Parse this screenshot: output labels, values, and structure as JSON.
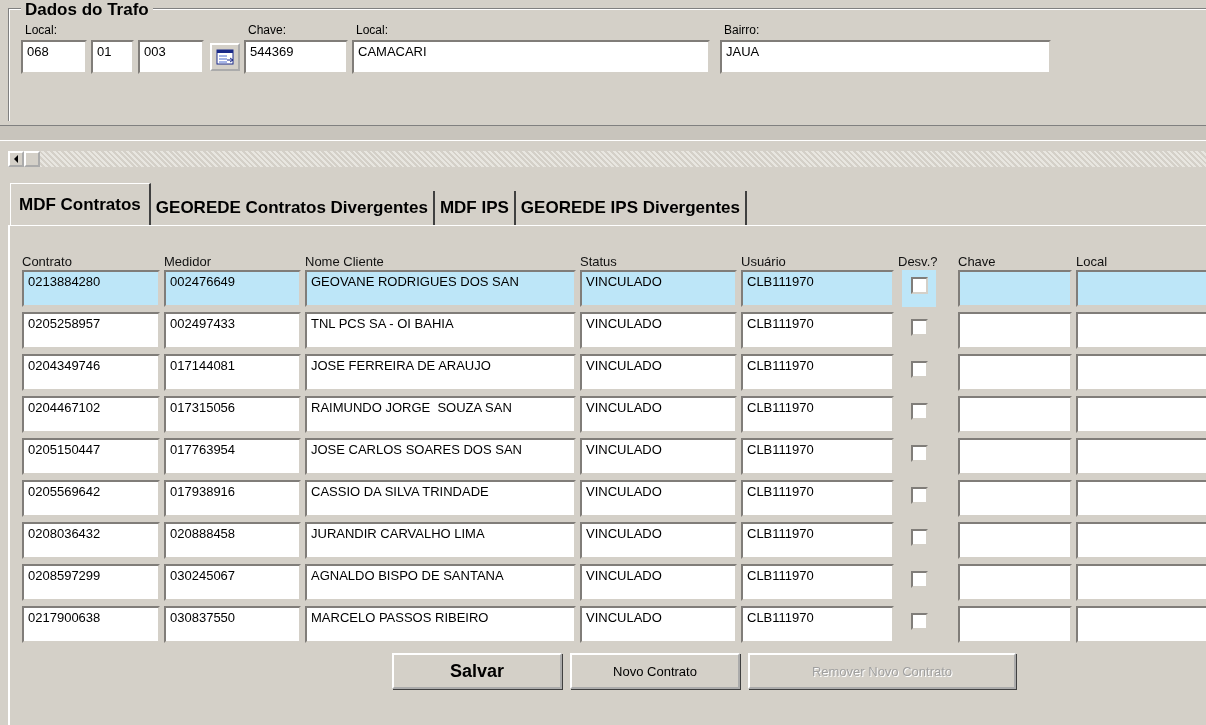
{
  "group": {
    "title": "Dados do Trafo",
    "fields": [
      {
        "label": "Local:",
        "parts": [
          "068",
          "01",
          "003"
        ]
      },
      {
        "label": "Chave:",
        "value": "544369"
      },
      {
        "label": "Local:",
        "value": "CAMACARI"
      },
      {
        "label": "Bairro:",
        "value": "JAUA"
      }
    ]
  },
  "tabs": [
    {
      "label": "MDF Contratos",
      "selected": true
    },
    {
      "label": "GEOREDE Contratos Divergentes",
      "selected": false
    },
    {
      "label": "MDF IPS",
      "selected": false
    },
    {
      "label": "GEOREDE IPS Divergentes",
      "selected": false
    }
  ],
  "table": {
    "columns": [
      "Contrato",
      "Medidor",
      "Nome Cliente",
      "Status",
      "Usuário",
      "Desv.?",
      "Chave",
      "Local"
    ],
    "rows": [
      {
        "selected": true,
        "cells": [
          "0213884280",
          "002476649",
          "GEOVANE RODRIGUES DOS SAN",
          "VINCULADO",
          "CLB111970"
        ],
        "checked": false
      },
      {
        "selected": false,
        "cells": [
          "0205258957",
          "002497433",
          "TNL PCS SA - OI BAHIA",
          "VINCULADO",
          "CLB111970"
        ],
        "checked": false
      },
      {
        "selected": false,
        "cells": [
          "0204349746",
          "017144081",
          "JOSE FERREIRA DE ARAUJO",
          "VINCULADO",
          "CLB111970"
        ],
        "checked": false
      },
      {
        "selected": false,
        "cells": [
          "0204467102",
          "017315056",
          "RAIMUNDO JORGE  SOUZA SAN",
          "VINCULADO",
          "CLB111970"
        ],
        "checked": false
      },
      {
        "selected": false,
        "cells": [
          "0205150447",
          "017763954",
          "JOSE CARLOS SOARES DOS SAN",
          "VINCULADO",
          "CLB111970"
        ],
        "checked": false
      },
      {
        "selected": false,
        "cells": [
          "0205569642",
          "017938916",
          "CASSIO DA SILVA TRINDADE",
          "VINCULADO",
          "CLB111970"
        ],
        "checked": false
      },
      {
        "selected": false,
        "cells": [
          "0208036432",
          "020888458",
          "JURANDIR CARVALHO LIMA",
          "VINCULADO",
          "CLB111970"
        ],
        "checked": false
      },
      {
        "selected": false,
        "cells": [
          "0208597299",
          "030245067",
          "AGNALDO BISPO DE SANTANA",
          "VINCULADO",
          "CLB111970"
        ],
        "checked": false
      },
      {
        "selected": false,
        "cells": [
          "0217900638",
          "030837550",
          "MARCELO PASSOS RIBEIRO",
          "VINCULADO",
          "CLB111970"
        ],
        "checked": false
      }
    ]
  },
  "buttons": [
    {
      "label": "Salvar",
      "kind": "primary",
      "disabled": false
    },
    {
      "label": "Novo Contrato",
      "kind": "normal",
      "disabled": false
    },
    {
      "label": "Remover Novo Contrato",
      "kind": "normal",
      "disabled": true
    }
  ]
}
